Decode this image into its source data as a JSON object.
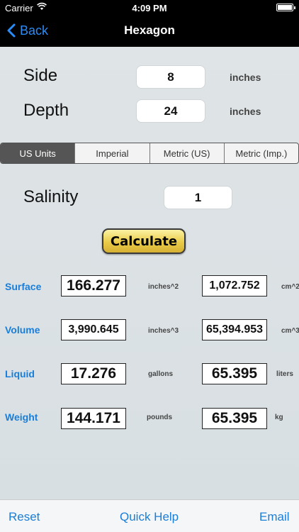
{
  "status_bar": {
    "carrier": "Carrier",
    "time": "4:09 PM"
  },
  "nav": {
    "back_label": "Back",
    "title": "Hexagon"
  },
  "inputs": {
    "side": {
      "label": "Side",
      "value": "8",
      "unit": "inches"
    },
    "depth": {
      "label": "Depth",
      "value": "24",
      "unit": "inches"
    }
  },
  "unit_tabs": [
    "US Units",
    "Imperial",
    "Metric (US)",
    "Metric (Imp.)"
  ],
  "selected_tab": "US Units",
  "salinity": {
    "label": "Salinity",
    "value": "1"
  },
  "calculate_label": "Calculate",
  "results": [
    {
      "label": "Surface",
      "value_us": "166.277",
      "unit_us": "inches^2",
      "value_metric": "1,072.752",
      "unit_metric": "cm^2"
    },
    {
      "label": "Volume",
      "value_us": "3,990.645",
      "unit_us": "inches^3",
      "value_metric": "65,394.953",
      "unit_metric": "cm^3"
    },
    {
      "label": "Liquid",
      "value_us": "17.276",
      "unit_us": "gallons",
      "value_metric": "65.395",
      "unit_metric": "liters"
    },
    {
      "label": "Weight",
      "value_us": "144.171",
      "unit_us": "pounds",
      "value_metric": "65.395",
      "unit_metric": "kg"
    }
  ],
  "toolbar": {
    "reset_label": "Reset",
    "help_label": "Quick Help",
    "email_label": "Email"
  }
}
